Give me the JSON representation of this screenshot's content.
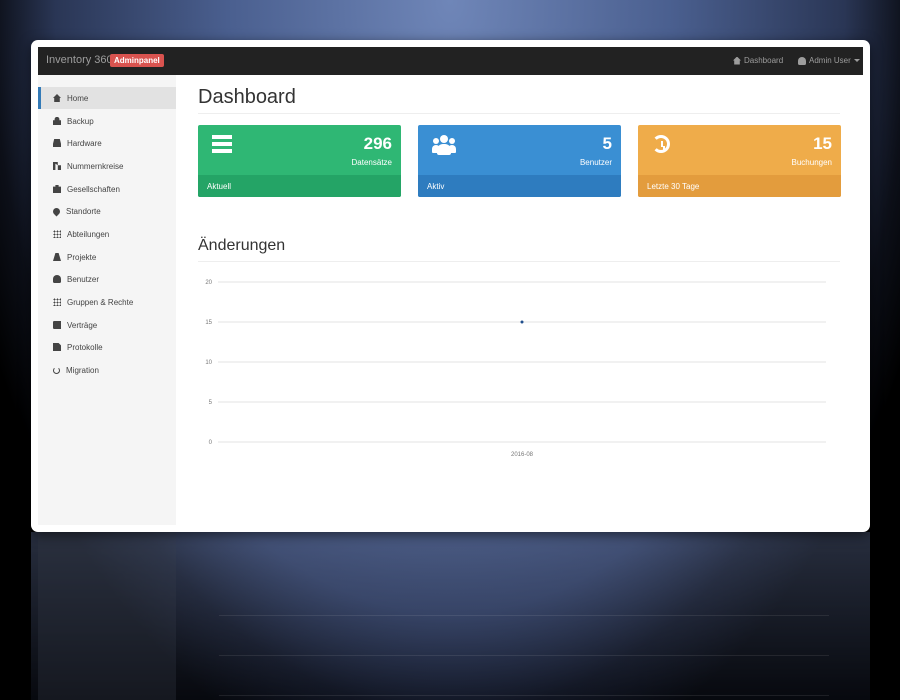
{
  "app": {
    "title": "Inventory 360",
    "badge": "Adminpanel"
  },
  "navbar": {
    "dashboard_label": "Dashboard",
    "user_label": "Admin User",
    "icons": [
      "home-icon",
      "user-icon"
    ]
  },
  "sidebar": {
    "items": [
      {
        "label": "Home",
        "icon": "home-icon",
        "active": true
      },
      {
        "label": "Backup",
        "icon": "lock-icon"
      },
      {
        "label": "Hardware",
        "icon": "hdd-icon"
      },
      {
        "label": "Nummernkreise",
        "icon": "sort-icon"
      },
      {
        "label": "Gesellschaften",
        "icon": "briefcase-icon"
      },
      {
        "label": "Standorte",
        "icon": "map-marker-icon"
      },
      {
        "label": "Abteilungen",
        "icon": "grid-icon"
      },
      {
        "label": "Projekte",
        "icon": "road-icon"
      },
      {
        "label": "Benutzer",
        "icon": "user-icon"
      },
      {
        "label": "Gruppen & Rechte",
        "icon": "grid-icon"
      },
      {
        "label": "Verträge",
        "icon": "book-icon"
      },
      {
        "label": "Protokolle",
        "icon": "file-icon"
      },
      {
        "label": "Migration",
        "icon": "refresh-icon"
      }
    ]
  },
  "main": {
    "title": "Dashboard",
    "panels": [
      {
        "value": "296",
        "label": "Datensätze",
        "footer": "Aktuell",
        "icon": "list-icon",
        "color": "#2fb774"
      },
      {
        "value": "5",
        "label": "Benutzer",
        "footer": "Aktiv",
        "icon": "users-icon",
        "color": "#3a8fd3"
      },
      {
        "value": "15",
        "label": "Buchungen",
        "footer": "Letzte 30 Tage",
        "icon": "history-icon",
        "color": "#efac4a"
      }
    ],
    "chart_title": "Änderungen"
  },
  "chart_data": {
    "type": "line",
    "x": [
      "2016-08"
    ],
    "series": [
      {
        "values": [
          15
        ]
      }
    ],
    "ylim": [
      0,
      20
    ],
    "yticks": [
      "0",
      "5",
      "10",
      "15",
      "20"
    ],
    "grid": true,
    "line_color": "#1f4e8c"
  }
}
